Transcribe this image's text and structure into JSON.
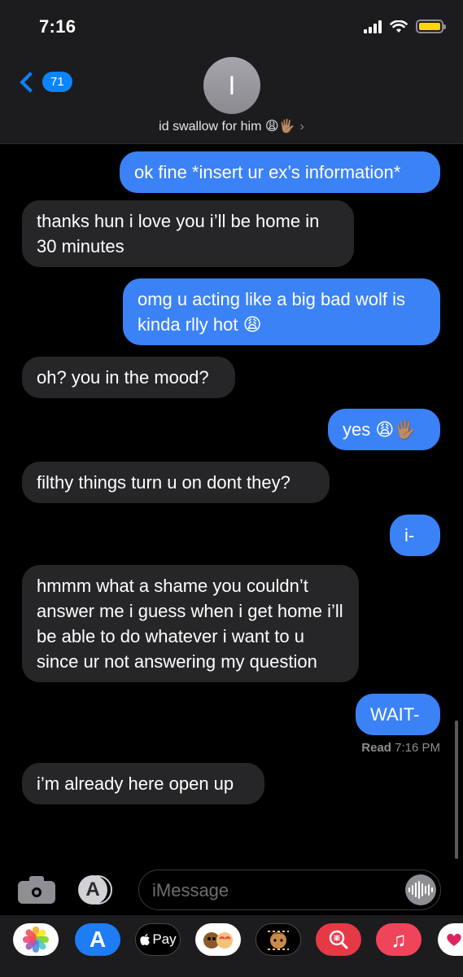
{
  "status_bar": {
    "time": "7:16"
  },
  "header": {
    "back_badge": "71",
    "avatar_initial": "I",
    "contact_name": "id swallow for him 😩🖐🏽",
    "contact_chevron": "›"
  },
  "messages": [
    {
      "direction": "out",
      "text": "ok fine *insert ur ex’s information*"
    },
    {
      "direction": "in",
      "text": "thanks hun i love you i’ll be home in 30 minutes"
    },
    {
      "direction": "out",
      "text": "omg u acting like a big bad wolf is kinda rlly hot 😩"
    },
    {
      "direction": "in",
      "text": "oh? you in the mood?"
    },
    {
      "direction": "out",
      "text": "yes 😩🖐🏽"
    },
    {
      "direction": "in",
      "text": "filthy things turn u on dont they?"
    },
    {
      "direction": "out",
      "text": "i-"
    },
    {
      "direction": "in",
      "text": "hmmm what a shame you couldn’t answer me i guess when i get home i’ll be able to do whatever i want to u since ur not answering my question"
    },
    {
      "direction": "out",
      "text": "WAIT-"
    },
    {
      "direction": "in",
      "text": "i’m already here open up"
    }
  ],
  "read_receipt": {
    "label": "Read",
    "time": "7:16 PM"
  },
  "input_bar": {
    "placeholder": "iMessage",
    "camera_icon": "camera-icon",
    "apps_icon": "app-store-icon",
    "audio_icon": "audio-waveform-icon"
  },
  "app_drawer": {
    "apps": [
      {
        "name": "photos-app-icon"
      },
      {
        "name": "app-store-app-icon",
        "glyph": "A"
      },
      {
        "name": "apple-pay-app-icon",
        "label": "Pay"
      },
      {
        "name": "memoji-stickers-app-icon"
      },
      {
        "name": "animoji-app-icon"
      },
      {
        "name": "images-search-app-icon"
      },
      {
        "name": "music-app-icon",
        "glyph": "♫"
      },
      {
        "name": "digital-touch-app-icon"
      }
    ]
  },
  "colors": {
    "outgoing_bubble": "#3b82f6",
    "incoming_bubble": "#262629",
    "accent": "#0a84ff",
    "battery": "#ffd60a"
  }
}
